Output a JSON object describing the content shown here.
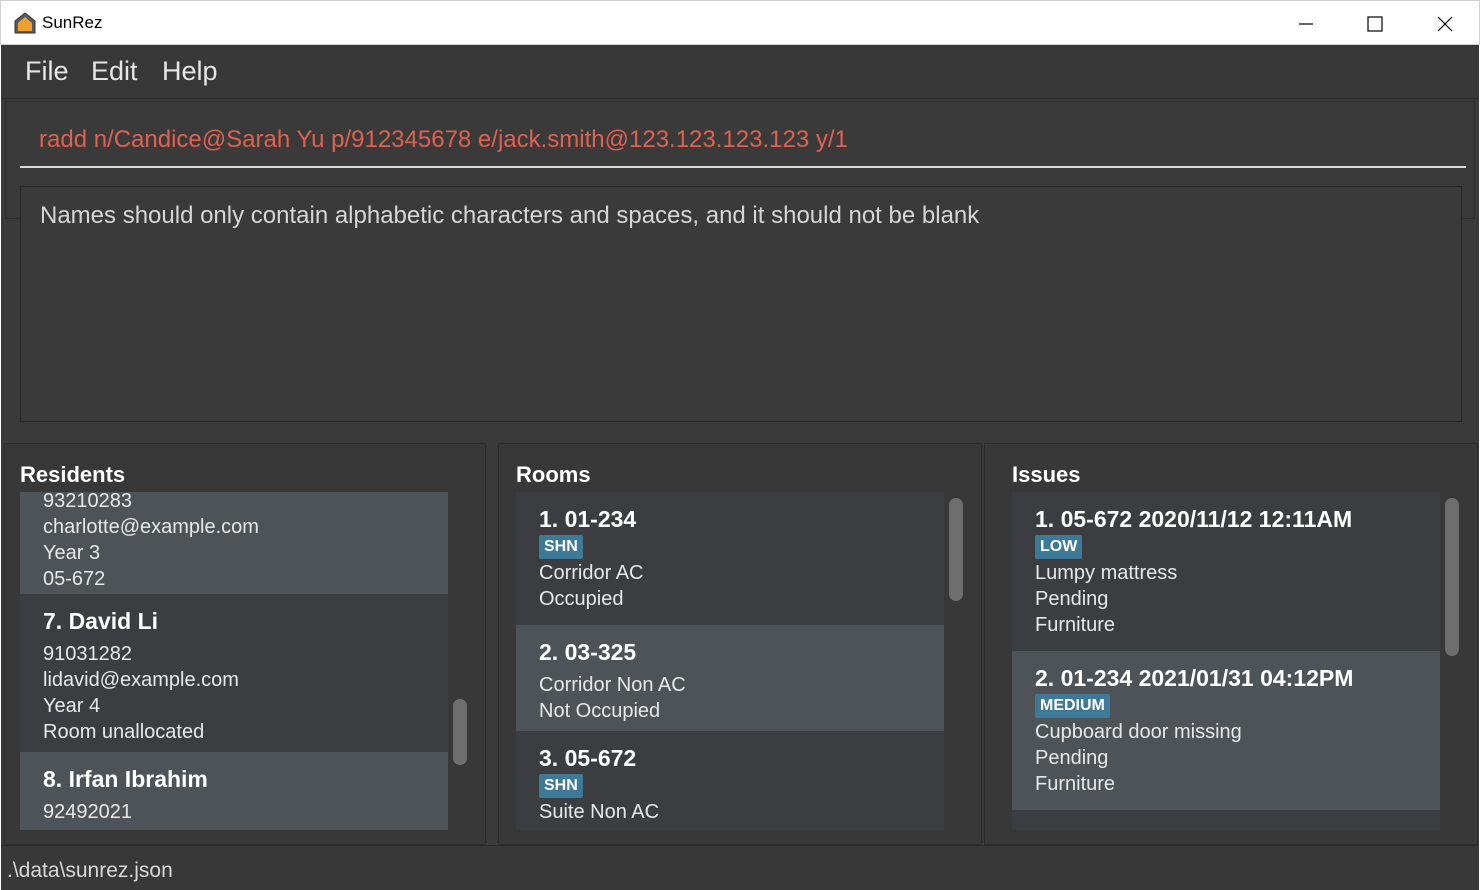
{
  "window": {
    "title": "SunRez",
    "minimize_icon": "minimize-icon",
    "maximize_icon": "maximize-icon",
    "close_icon": "close-icon"
  },
  "menu": {
    "file": "File",
    "edit": "Edit",
    "help": "Help"
  },
  "command": {
    "value": "radd n/Candice@Sarah Yu p/912345678 e/jack.smith@123.123.123.123 y/1"
  },
  "result": {
    "message": "Names should only contain alphabetic characters and spaces, and it should not be blank"
  },
  "residents": {
    "title": "Residents",
    "items": [
      {
        "lines": [
          "93210283",
          "charlotte@example.com",
          "Year 3",
          "05-672"
        ]
      },
      {
        "heading": "7.  David Li",
        "lines": [
          "91031282",
          "lidavid@example.com",
          "Year 4",
          "Room unallocated"
        ]
      },
      {
        "heading": "8.  Irfan Ibrahim",
        "lines": [
          "92492021"
        ]
      }
    ]
  },
  "rooms": {
    "title": "Rooms",
    "items": [
      {
        "heading": "1.  01-234",
        "tag": "SHN",
        "lines": [
          "Corridor AC",
          "Occupied"
        ]
      },
      {
        "heading": "2.  03-325",
        "lines": [
          "Corridor Non AC",
          "Not Occupied"
        ]
      },
      {
        "heading": "3.  05-672",
        "tag": "SHN",
        "lines": [
          "Suite Non AC"
        ]
      }
    ]
  },
  "issues": {
    "title": "Issues",
    "items": [
      {
        "heading": "1.  05-672  2020/11/12 12:11AM",
        "tag": "LOW",
        "lines": [
          "Lumpy mattress",
          "Pending",
          "Furniture"
        ]
      },
      {
        "heading": "2.  01-234  2021/01/31 04:12PM",
        "tag": "MEDIUM",
        "lines": [
          "Cupboard door missing",
          "Pending",
          "Furniture"
        ]
      }
    ]
  },
  "status": {
    "path": ".\\data\\sunrez.json"
  }
}
